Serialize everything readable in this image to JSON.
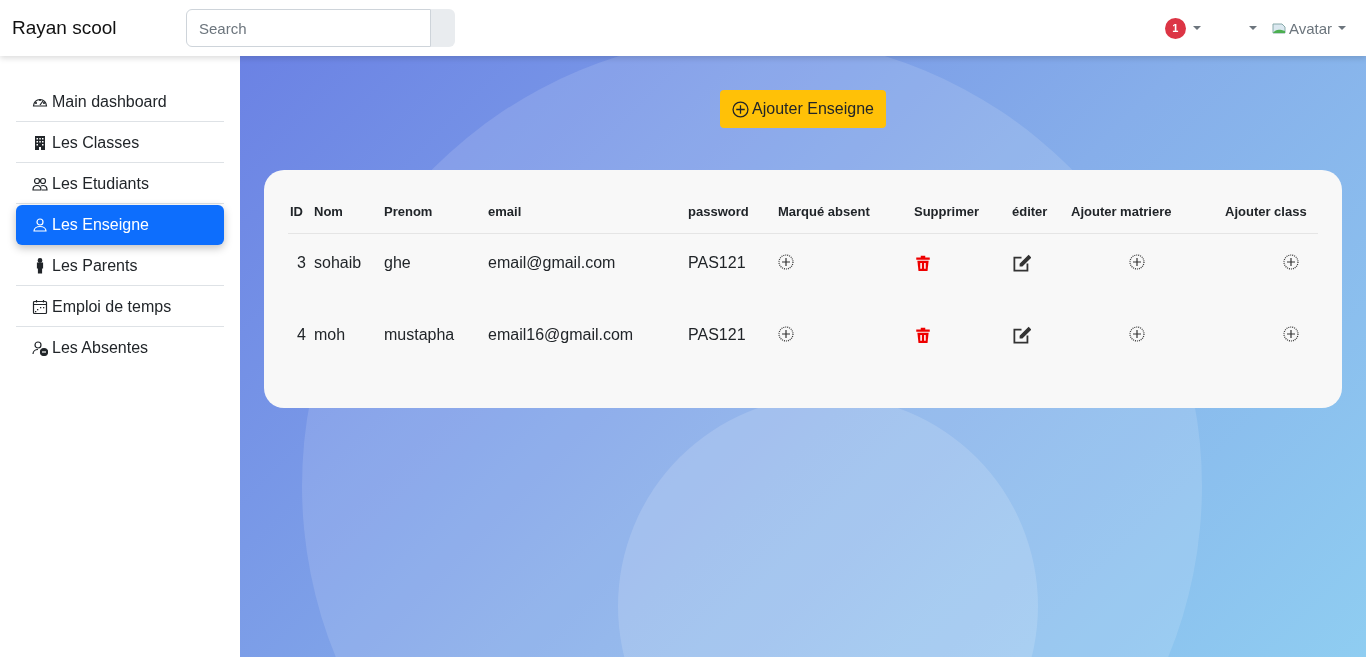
{
  "navbar": {
    "brand": "Rayan scool",
    "search": {
      "placeholder": "Search"
    },
    "notifications": {
      "count": "1"
    },
    "avatar": {
      "alt": "Avatar"
    }
  },
  "sidebar": {
    "items": [
      {
        "label": "Main dashboard",
        "selected": false
      },
      {
        "label": "Les Classes",
        "selected": false
      },
      {
        "label": "Les Etudiants",
        "selected": false
      },
      {
        "label": "Les Enseigne",
        "selected": true
      },
      {
        "label": "Les Parents",
        "selected": false
      },
      {
        "label": "Emploi de temps",
        "selected": false
      },
      {
        "label": "Les Absentes",
        "selected": false
      }
    ]
  },
  "add_button": {
    "label": "Ajouter Enseigne"
  },
  "table": {
    "columns": [
      "ID",
      "Nom",
      "Prenom",
      "email",
      "password",
      "Marqué absent",
      "Supprimer",
      "éditer",
      "Ajouter matriere",
      "Ajouter class"
    ],
    "rows": [
      {
        "id": "3",
        "nom": "sohaib",
        "prenom": "ghe",
        "email": "email@gmail.com",
        "password": "PAS121"
      },
      {
        "id": "4",
        "nom": "moh",
        "prenom": "mustapha",
        "email": "email16@gmail.com",
        "password": "PAS121"
      }
    ]
  }
}
